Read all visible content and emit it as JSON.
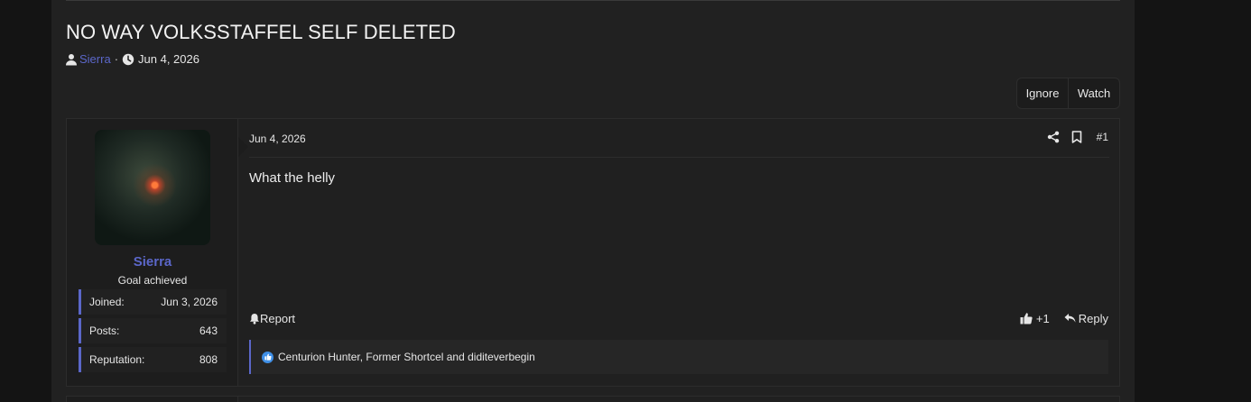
{
  "thread": {
    "title": "NO WAY VOLKSSTAFFEL SELF DELETED",
    "author": "Sierra",
    "separator": "·",
    "date": "Jun 4, 2026"
  },
  "header_buttons": {
    "ignore": "Ignore",
    "watch": "Watch"
  },
  "post": {
    "user": {
      "name": "Sierra",
      "title": "Goal achieved",
      "stats": [
        {
          "label": "Joined:",
          "value": "Jun 3, 2026"
        },
        {
          "label": "Posts:",
          "value": "643"
        },
        {
          "label": "Reputation:",
          "value": "808"
        }
      ]
    },
    "date": "Jun 4, 2026",
    "number": "#1",
    "body": "What the helly",
    "report_label": "Report",
    "reaction_count": "+1",
    "reply_label": "Reply",
    "reactions_summary": "Centurion Hunter, Former Shortcel and diditeverbegin"
  },
  "colors": {
    "accent": "#5b67c9",
    "background": "#212121",
    "like_blue": "#3f8fe6"
  },
  "icons": [
    "user-icon",
    "clock-icon",
    "share-icon",
    "bookmark-icon",
    "bell-icon",
    "thumbs-up-icon",
    "reply-icon",
    "like-reaction-icon"
  ]
}
